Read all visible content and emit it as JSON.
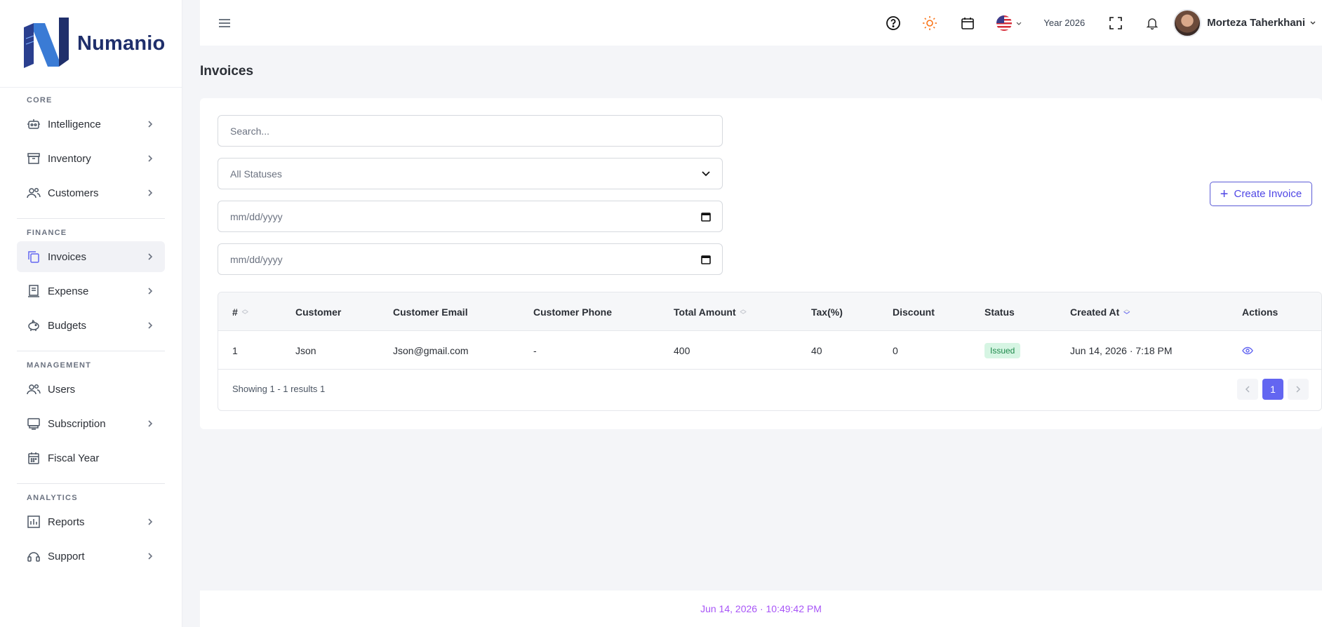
{
  "brand": {
    "name": "Numanio"
  },
  "sidebar": {
    "sections": [
      {
        "title": "CORE",
        "items": [
          {
            "label": "Intelligence",
            "icon": "robot-icon",
            "chevron": true
          },
          {
            "label": "Inventory",
            "icon": "archive-icon",
            "chevron": true
          },
          {
            "label": "Customers",
            "icon": "users-icon",
            "chevron": true
          }
        ]
      },
      {
        "title": "FINANCE",
        "items": [
          {
            "label": "Invoices",
            "icon": "invoice-icon",
            "chevron": true,
            "active": true
          },
          {
            "label": "Expense",
            "icon": "receipt-icon",
            "chevron": true
          },
          {
            "label": "Budgets",
            "icon": "piggy-bank-icon",
            "chevron": true
          }
        ]
      },
      {
        "title": "MANAGEMENT",
        "items": [
          {
            "label": "Users",
            "icon": "users-icon",
            "chevron": false
          },
          {
            "label": "Subscription",
            "icon": "monitor-icon",
            "chevron": true
          },
          {
            "label": "Fiscal Year",
            "icon": "calendar-icon",
            "chevron": false
          }
        ]
      },
      {
        "title": "ANALYTICS",
        "items": [
          {
            "label": "Reports",
            "icon": "bar-chart-icon",
            "chevron": true
          },
          {
            "label": "Support",
            "icon": "headset-icon",
            "chevron": true
          }
        ]
      }
    ]
  },
  "topbar": {
    "year_label": "Year 2026",
    "user_name": "Morteza Taherkhani",
    "accent_sun": "#f97316"
  },
  "page": {
    "title": "Invoices"
  },
  "filters": {
    "search_placeholder": "Search...",
    "status_value": "All Statuses",
    "date_from": "mm/dd/yyyy",
    "date_to": "mm/dd/yyyy"
  },
  "actions": {
    "create_label": "Create Invoice"
  },
  "table": {
    "headers": {
      "num": "#",
      "customer": "Customer",
      "email": "Customer Email",
      "phone": "Customer Phone",
      "total": "Total Amount",
      "tax": "Tax(%)",
      "discount": "Discount",
      "status": "Status",
      "created": "Created At",
      "actions": "Actions"
    },
    "rows": [
      {
        "num": "1",
        "customer": "Json",
        "email": "Json@gmail.com",
        "phone": "-",
        "total": "400",
        "tax": "40",
        "discount": "0",
        "status": "Issued",
        "created": "Jun 14, 2026 · 7:18 PM"
      }
    ],
    "showing": "Showing 1 - 1 results 1",
    "current_page": "1"
  },
  "footer": {
    "timestamp": "Jun 14, 2026 · 10:49:42 PM"
  },
  "colors": {
    "accent": "#6366f1",
    "brand": "#1f2f6b",
    "badge_bg": "#d6f5e3",
    "badge_text": "#1f8a4c",
    "footer_time": "#a855f7"
  }
}
